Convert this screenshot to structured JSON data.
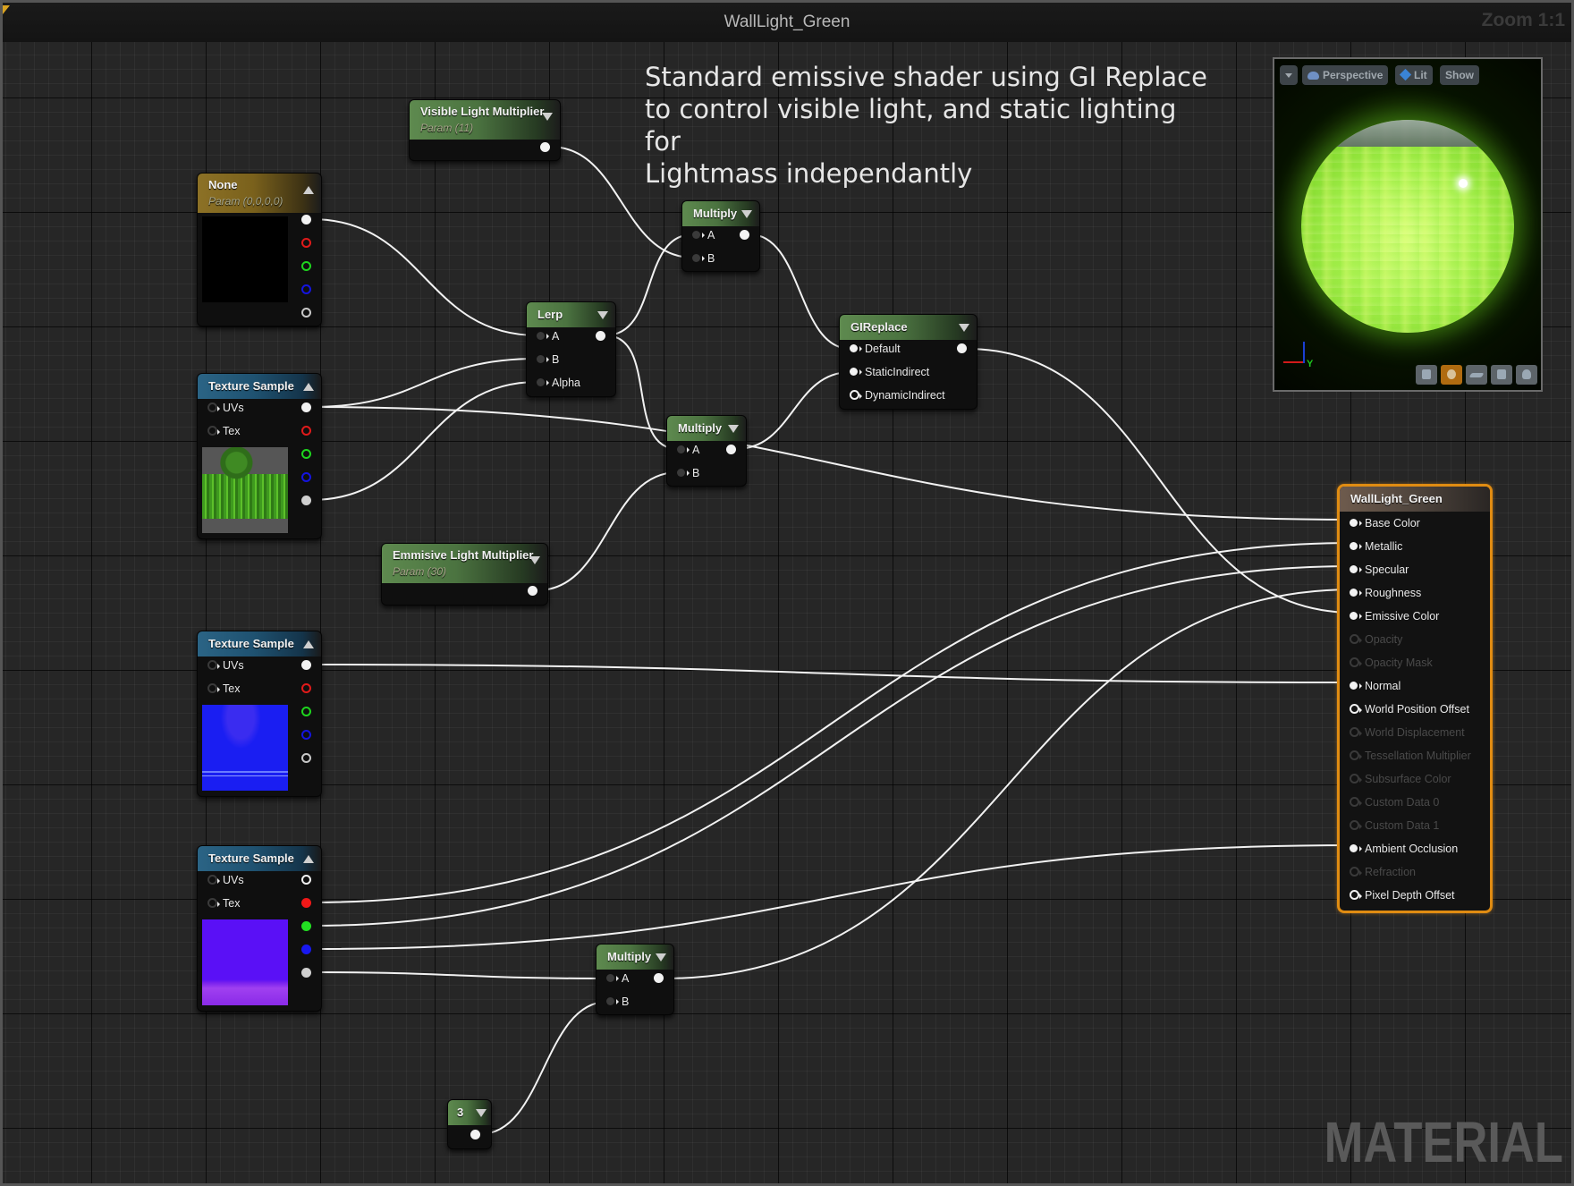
{
  "window": {
    "title": "WallLight_Green",
    "zoom_label": "Zoom 1:1",
    "watermark": "MATERIAL"
  },
  "comment": {
    "text": "Standard emissive shader using GI Replace\nto control visible light, and static lighting for\nLightmass independantly"
  },
  "preview": {
    "menu_icon": "chevron-down-icon",
    "perspective_label": "Perspective",
    "lit_label": "Lit",
    "show_label": "Show",
    "axis_y_label": "Y",
    "shape_buttons": [
      "cylinder-icon",
      "sphere-icon",
      "plane-icon",
      "cube-icon",
      "custom-mesh-icon"
    ],
    "active_shape": "sphere-icon"
  },
  "nodes": {
    "vector_param": {
      "title": "None",
      "subtitle": "Param (0,0,0,0)",
      "header_color": "#8c7126",
      "outputs": [
        "rgba",
        "r",
        "g",
        "b",
        "a"
      ]
    },
    "visible_light_multiplier": {
      "title": "Visible Light Multiplier",
      "subtitle": "Param (11)",
      "header_color": "#5e8a4f"
    },
    "emissive_light_multiplier": {
      "title": "Emmisive Light Multiplier",
      "subtitle": "Param (30)",
      "header_color": "#5e8a4f"
    },
    "texture_sample_1": {
      "title": "Texture Sample",
      "inputs": [
        "UVs",
        "Tex"
      ],
      "header_color": "#2b6485"
    },
    "texture_sample_2": {
      "title": "Texture Sample",
      "inputs": [
        "UVs",
        "Tex"
      ],
      "header_color": "#2b6485"
    },
    "texture_sample_3": {
      "title": "Texture Sample",
      "inputs": [
        "UVs",
        "Tex"
      ],
      "header_color": "#2b6485"
    },
    "lerp": {
      "title": "Lerp",
      "inputs": [
        "A",
        "B",
        "Alpha"
      ]
    },
    "multiply_1": {
      "title": "Multiply",
      "inputs": [
        "A",
        "B"
      ]
    },
    "multiply_2": {
      "title": "Multiply",
      "inputs": [
        "A",
        "B"
      ]
    },
    "multiply_3": {
      "title": "Multiply",
      "inputs": [
        "A",
        "B"
      ]
    },
    "gi_replace": {
      "title": "GIReplace",
      "inputs": [
        "Default",
        "StaticIndirect",
        "DynamicIndirect"
      ]
    },
    "constant": {
      "title": "3"
    },
    "result": {
      "title": "WallLight_Green",
      "accent_color": "#e08c12",
      "inputs": [
        {
          "label": "Base Color",
          "state": "connected"
        },
        {
          "label": "Metallic",
          "state": "connected"
        },
        {
          "label": "Specular",
          "state": "connected"
        },
        {
          "label": "Roughness",
          "state": "connected"
        },
        {
          "label": "Emissive Color",
          "state": "connected"
        },
        {
          "label": "Opacity",
          "state": "disabled"
        },
        {
          "label": "Opacity Mask",
          "state": "disabled"
        },
        {
          "label": "Normal",
          "state": "connected"
        },
        {
          "label": "World Position Offset",
          "state": "available"
        },
        {
          "label": "World Displacement",
          "state": "disabled"
        },
        {
          "label": "Tessellation Multiplier",
          "state": "disabled"
        },
        {
          "label": "Subsurface Color",
          "state": "disabled"
        },
        {
          "label": "Custom Data 0",
          "state": "disabled"
        },
        {
          "label": "Custom Data 1",
          "state": "disabled"
        },
        {
          "label": "Ambient Occlusion",
          "state": "connected"
        },
        {
          "label": "Refraction",
          "state": "disabled"
        },
        {
          "label": "Pixel Depth Offset",
          "state": "available"
        }
      ]
    }
  },
  "connections": [
    {
      "from": "vector_param.rgba",
      "to": "lerp.A"
    },
    {
      "from": "texture_sample_1.rgba",
      "to": "lerp.B"
    },
    {
      "from": "texture_sample_1.a",
      "to": "lerp.Alpha"
    },
    {
      "from": "texture_sample_1.rgba",
      "to": "result.Base Color"
    },
    {
      "from": "lerp.out",
      "to": "multiply_1.A"
    },
    {
      "from": "visible_light_multiplier.out",
      "to": "multiply_1.B"
    },
    {
      "from": "lerp.out",
      "to": "multiply_2.A"
    },
    {
      "from": "emissive_light_multiplier.out",
      "to": "multiply_2.B"
    },
    {
      "from": "multiply_1.out",
      "to": "gi_replace.Default"
    },
    {
      "from": "multiply_2.out",
      "to": "gi_replace.StaticIndirect"
    },
    {
      "from": "gi_replace.out",
      "to": "result.Emissive Color"
    },
    {
      "from": "texture_sample_2.rgba",
      "to": "result.Normal"
    },
    {
      "from": "texture_sample_3.r",
      "to": "result.Metallic"
    },
    {
      "from": "texture_sample_3.g",
      "to": "result.Specular"
    },
    {
      "from": "texture_sample_3.b",
      "to": "result.Ambient Occlusion"
    },
    {
      "from": "texture_sample_3.a",
      "to": "multiply_3.A"
    },
    {
      "from": "constant.out",
      "to": "multiply_3.B"
    },
    {
      "from": "multiply_3.out",
      "to": "result.Roughness"
    }
  ]
}
